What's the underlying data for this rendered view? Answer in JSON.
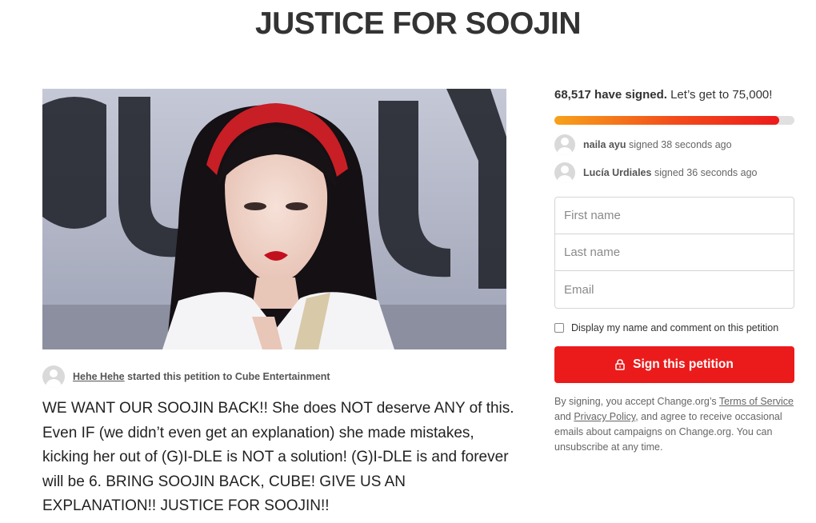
{
  "page": {
    "title": "JUSTICE FOR SOOJIN"
  },
  "petition": {
    "starter_name": "Hehe Hehe",
    "starter_suffix": "started this petition to Cube Entertainment",
    "body": "WE WANT OUR SOOJIN BACK!! She does NOT deserve ANY of this. Even IF (we didn’t even get an explanation) she made mistakes, kicking her out of (G)I-DLE is NOT a solution! (G)I-DLE is and forever will be 6. BRING SOOJIN BACK, CUBE! GIVE US AN EXPLANATION!! JUSTICE FOR SOOJIN!!"
  },
  "signatures": {
    "count_text": "68,517 have signed.",
    "goal_text": "Let’s get to 75,000!",
    "count": 68517,
    "goal": 75000,
    "progress_fraction": 0.935,
    "progress_colors": [
      "#f7a21b",
      "#ec1b1b"
    ]
  },
  "recent_signers": [
    {
      "name": "naila ayu",
      "suffix": "signed 38 seconds ago"
    },
    {
      "name": "Lucía Urdiales",
      "suffix": "signed 36 seconds ago"
    }
  ],
  "form": {
    "first_name_placeholder": "First name",
    "last_name_placeholder": "Last name",
    "email_placeholder": "Email",
    "display_checkbox_label": "Display my name and comment on this petition",
    "display_checkbox_checked": false,
    "sign_button_label": "Sign this petition",
    "sign_button_icon": "lock-icon",
    "sign_button_color": "#ec1b1b"
  },
  "disclaimer": {
    "prefix": "By signing, you accept Change.org’s ",
    "terms_link": "Terms of Service",
    "and": " and ",
    "privacy_link": "Privacy Policy",
    "suffix": ", and agree to receive occasional emails about campaigns on Change.org. You can unsubscribe at any time."
  }
}
